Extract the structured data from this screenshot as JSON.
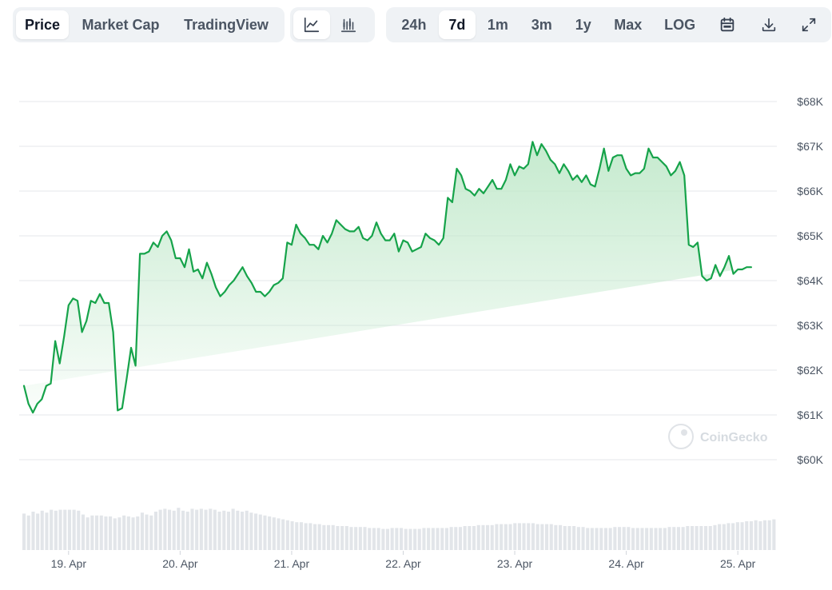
{
  "toolbar": {
    "metric_tabs": [
      {
        "label": "Price",
        "active": true
      },
      {
        "label": "Market Cap",
        "active": false
      },
      {
        "label": "TradingView",
        "active": false
      }
    ],
    "chart_style_icons": [
      "line-chart-icon",
      "candlestick-chart-icon"
    ],
    "ranges": [
      {
        "label": "24h",
        "active": false
      },
      {
        "label": "7d",
        "active": true
      },
      {
        "label": "1m",
        "active": false
      },
      {
        "label": "3m",
        "active": false
      },
      {
        "label": "1y",
        "active": false
      },
      {
        "label": "Max",
        "active": false
      },
      {
        "label": "LOG",
        "active": false
      }
    ],
    "action_icons": [
      "calendar-icon",
      "download-icon",
      "expand-icon"
    ]
  },
  "watermark": "CoinGecko",
  "colors": {
    "line": "#16a34a",
    "area_top": "#bfe8c9",
    "grid": "#e5e7eb",
    "volume": "#e2e5e9"
  },
  "chart_data": {
    "type": "area",
    "title": "",
    "xlabel": "",
    "ylabel": "",
    "x_range": [
      18.6,
      25.35
    ],
    "ylim": [
      60000,
      68000
    ],
    "y_ticks": [
      {
        "value": 68000,
        "label": "$68K"
      },
      {
        "value": 67000,
        "label": "$67K"
      },
      {
        "value": 66000,
        "label": "$66K"
      },
      {
        "value": 65000,
        "label": "$65K"
      },
      {
        "value": 64000,
        "label": "$64K"
      },
      {
        "value": 63000,
        "label": "$63K"
      },
      {
        "value": 62000,
        "label": "$62K"
      },
      {
        "value": 61000,
        "label": "$61K"
      },
      {
        "value": 60000,
        "label": "$60K"
      }
    ],
    "x_ticks": [
      {
        "value": 19,
        "label": "19. Apr"
      },
      {
        "value": 20,
        "label": "20. Apr"
      },
      {
        "value": 21,
        "label": "21. Apr"
      },
      {
        "value": 22,
        "label": "22. Apr"
      },
      {
        "value": 23,
        "label": "23. Apr"
      },
      {
        "value": 24,
        "label": "24. Apr"
      },
      {
        "value": 25,
        "label": "25. Apr"
      }
    ],
    "price_series": {
      "x": [
        18.6,
        18.64,
        18.68,
        18.72,
        18.76,
        18.8,
        18.84,
        18.88,
        18.92,
        18.96,
        19.0,
        19.04,
        19.08,
        19.12,
        19.16,
        19.2,
        19.24,
        19.28,
        19.32,
        19.36,
        19.4,
        19.44,
        19.48,
        19.52,
        19.56,
        19.6,
        19.64,
        19.68,
        19.72,
        19.76,
        19.8,
        19.84,
        19.88,
        19.92,
        19.96,
        20.0,
        20.04,
        20.08,
        20.12,
        20.16,
        20.2,
        20.24,
        20.28,
        20.32,
        20.36,
        20.4,
        20.44,
        20.48,
        20.52,
        20.56,
        20.6,
        20.64,
        20.68,
        20.72,
        20.76,
        20.8,
        20.84,
        20.88,
        20.92,
        20.96,
        21.0,
        21.04,
        21.08,
        21.12,
        21.16,
        21.2,
        21.24,
        21.28,
        21.32,
        21.36,
        21.4,
        21.44,
        21.48,
        21.52,
        21.56,
        21.6,
        21.64,
        21.68,
        21.72,
        21.76,
        21.8,
        21.84,
        21.88,
        21.92,
        21.96,
        22.0,
        22.04,
        22.08,
        22.12,
        22.16,
        22.2,
        22.24,
        22.28,
        22.32,
        22.36,
        22.4,
        22.44,
        22.48,
        22.52,
        22.56,
        22.6,
        22.64,
        22.68,
        22.72,
        22.76,
        22.8,
        22.84,
        22.88,
        22.92,
        22.96,
        23.0,
        23.04,
        23.08,
        23.12,
        23.16,
        23.2,
        23.24,
        23.28,
        23.32,
        23.36,
        23.4,
        23.44,
        23.48,
        23.52,
        23.56,
        23.6,
        23.64,
        23.68,
        23.72,
        23.76,
        23.8,
        23.84,
        23.88,
        23.92,
        23.96,
        24.0,
        24.04,
        24.08,
        24.12,
        24.16,
        24.2,
        24.24,
        24.28,
        24.32,
        24.36,
        24.4,
        24.44,
        24.48,
        24.52,
        24.56,
        24.6,
        24.64,
        24.68,
        24.72,
        24.76,
        24.8,
        24.84,
        24.88,
        24.92,
        24.96,
        25.0,
        25.04,
        25.08,
        25.12,
        25.16,
        25.2,
        25.24,
        25.28,
        25.32,
        25.35
      ],
      "y": [
        61650,
        61250,
        61050,
        61250,
        61350,
        61650,
        61700,
        62650,
        62150,
        62750,
        63450,
        63600,
        63550,
        62850,
        63100,
        63550,
        63500,
        63700,
        63500,
        63500,
        62850,
        61100,
        61150,
        61800,
        62500,
        62100,
        64600,
        64600,
        64650,
        64850,
        64750,
        65000,
        65100,
        64900,
        64500,
        64500,
        64300,
        64700,
        64200,
        64250,
        64050,
        64400,
        64150,
        63850,
        63650,
        63750,
        63900,
        64000,
        64150,
        64300,
        64100,
        63950,
        63750,
        63750,
        63650,
        63750,
        63900,
        63950,
        64050,
        64850,
        64800,
        65250,
        65050,
        64950,
        64800,
        64800,
        64700,
        65000,
        64850,
        65050,
        65350,
        65250,
        65150,
        65100,
        65100,
        65200,
        64950,
        64900,
        65000,
        65300,
        65050,
        64900,
        64900,
        65050,
        64650,
        64900,
        64850,
        64650,
        64700,
        64750,
        65050,
        64950,
        64900,
        64800,
        64950,
        65850,
        65750,
        66500,
        66350,
        66050,
        66000,
        65900,
        66050,
        65950,
        66100,
        66250,
        66050,
        66050,
        66250,
        66600,
        66350,
        66550,
        66500,
        66600,
        67100,
        66800,
        67050,
        66900,
        66700,
        66600,
        66400,
        66600,
        66450,
        66250,
        66350,
        66200,
        66350,
        66150,
        66100,
        66500,
        66950,
        66450,
        66750,
        66800,
        66800,
        66500,
        66350,
        66400,
        66400,
        66500,
        66950,
        66750,
        66750,
        66650,
        66550,
        66350,
        66450,
        66650,
        66350,
        64800,
        64750,
        64850,
        64100,
        64000,
        64050,
        64350,
        64100,
        64300,
        64550,
        64150,
        64250,
        64250,
        64300,
        64300
      ],
      "line_color": "#16a34a"
    },
    "volume_bars": [
      0.76,
      0.72,
      0.8,
      0.76,
      0.82,
      0.78,
      0.84,
      0.82,
      0.84,
      0.84,
      0.84,
      0.84,
      0.82,
      0.74,
      0.68,
      0.72,
      0.72,
      0.72,
      0.7,
      0.7,
      0.66,
      0.68,
      0.72,
      0.7,
      0.68,
      0.7,
      0.78,
      0.74,
      0.72,
      0.8,
      0.84,
      0.86,
      0.84,
      0.82,
      0.88,
      0.82,
      0.8,
      0.86,
      0.84,
      0.86,
      0.84,
      0.86,
      0.84,
      0.8,
      0.82,
      0.8,
      0.86,
      0.82,
      0.8,
      0.82,
      0.78,
      0.76,
      0.74,
      0.72,
      0.7,
      0.68,
      0.66,
      0.64,
      0.62,
      0.6,
      0.58,
      0.58,
      0.56,
      0.56,
      0.54,
      0.54,
      0.52,
      0.52,
      0.52,
      0.5,
      0.5,
      0.5,
      0.48,
      0.48,
      0.48,
      0.48,
      0.46,
      0.46,
      0.46,
      0.44,
      0.44,
      0.46,
      0.46,
      0.46,
      0.44,
      0.44,
      0.44,
      0.44,
      0.46,
      0.46,
      0.46,
      0.46,
      0.46,
      0.46,
      0.48,
      0.48,
      0.48,
      0.5,
      0.5,
      0.5,
      0.52,
      0.52,
      0.52,
      0.52,
      0.54,
      0.54,
      0.54,
      0.54,
      0.56,
      0.56,
      0.56,
      0.56,
      0.56,
      0.54,
      0.54,
      0.54,
      0.54,
      0.52,
      0.52,
      0.5,
      0.5,
      0.5,
      0.48,
      0.48,
      0.46,
      0.46,
      0.46,
      0.46,
      0.46,
      0.46,
      0.48,
      0.48,
      0.48,
      0.48,
      0.46,
      0.46,
      0.46,
      0.46,
      0.46,
      0.46,
      0.46,
      0.46,
      0.48,
      0.48,
      0.48,
      0.48,
      0.5,
      0.5,
      0.5,
      0.5,
      0.5,
      0.5,
      0.52,
      0.54,
      0.54,
      0.56,
      0.56,
      0.58,
      0.58,
      0.6,
      0.6,
      0.62,
      0.6,
      0.62,
      0.62,
      0.64
    ]
  }
}
